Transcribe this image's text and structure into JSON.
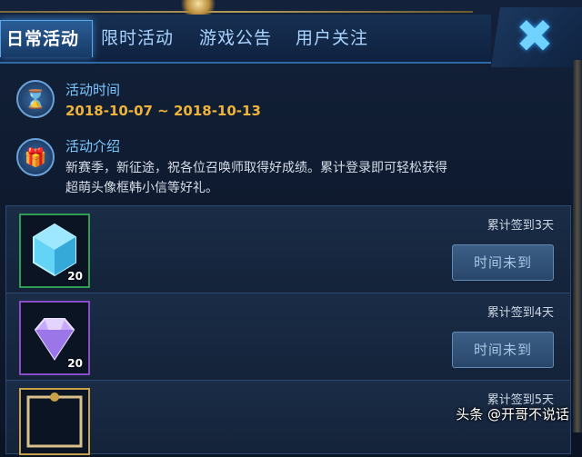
{
  "tabs": [
    {
      "label": "日常活动",
      "active": true
    },
    {
      "label": "限时活动",
      "active": false
    },
    {
      "label": "游戏公告",
      "active": false
    },
    {
      "label": "用户关注",
      "active": false
    }
  ],
  "close_icon": "close-icon",
  "event": {
    "time_label": "活动时间",
    "time_value": "2018-10-07 ~ 2018-10-13",
    "intro_label": "活动介绍",
    "intro_line1": "新赛季，新征途，祝各位召唤师取得好成绩。累计登录即可轻松获得",
    "intro_line2": "超萌头像框韩小信等好礼。"
  },
  "rewards": [
    {
      "streak": "累计签到3天",
      "qty": "20",
      "status": "时间未到",
      "icon": "blue-crystal-icon",
      "frame_color": "#2f9c54"
    },
    {
      "streak": "累计签到4天",
      "qty": "20",
      "status": "时间未到",
      "icon": "purple-diamond-icon",
      "frame_color": "#8a4cc8"
    },
    {
      "streak": "累计签到5天",
      "qty": "",
      "status": "",
      "icon": "avatar-frame-icon",
      "frame_color": "#c9a04a"
    }
  ],
  "watermark": "头条 @开哥不说话",
  "colors": {
    "accent": "#7ec8ff",
    "date": "#f0b33a",
    "button": "#3c5f86"
  }
}
